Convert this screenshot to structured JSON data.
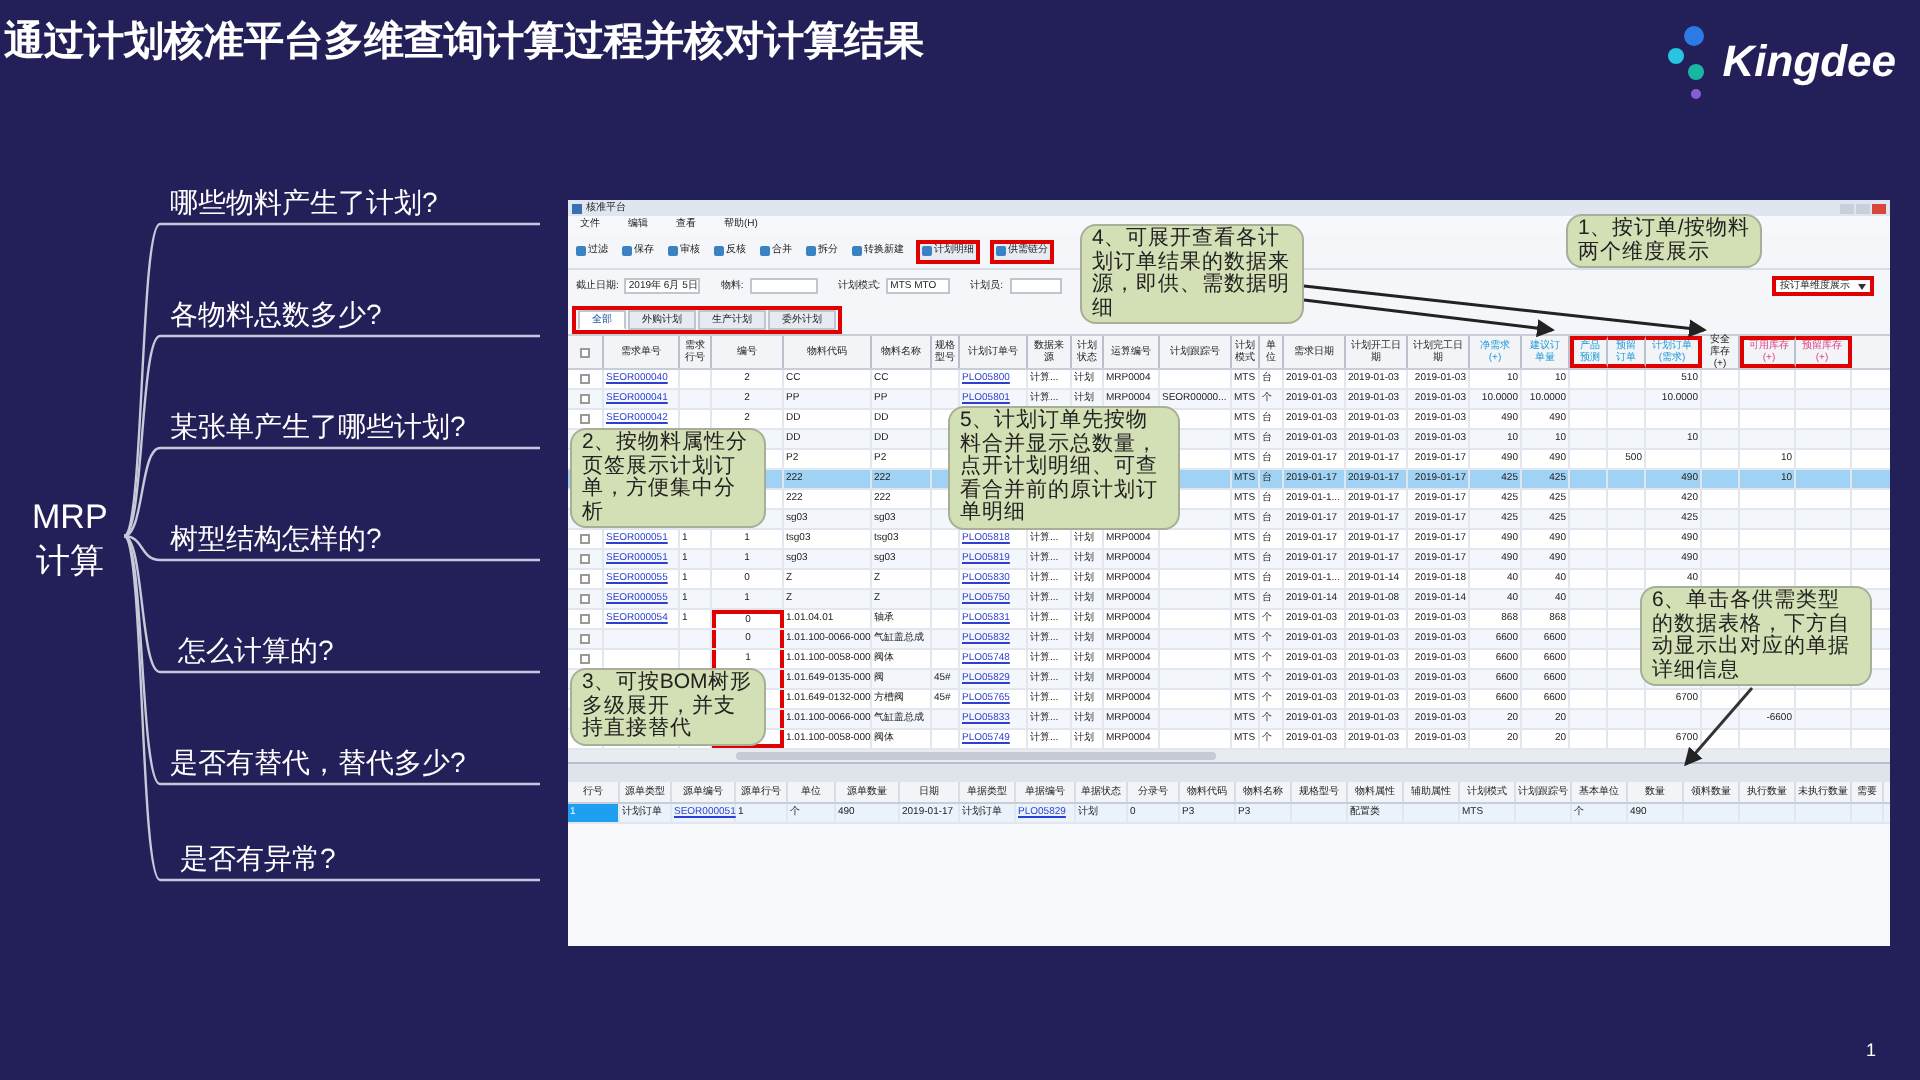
{
  "title": "通过计划核准平台多维查询计算过程并核对计算结果",
  "logo": {
    "text": "Kingdee"
  },
  "topic": {
    "lines": [
      "MRP",
      "计算"
    ]
  },
  "questions": [
    "哪些物料产生了计划?",
    "各物料总数多少?",
    "某张单产生了哪些计划?",
    "树型结构怎样的?",
    "怎么计算的?",
    "是否有替代，替代多少?",
    "是否有异常?"
  ],
  "app": {
    "title": "核准平台",
    "menu": [
      "文件",
      "编辑",
      "查看",
      "帮助(H)"
    ],
    "toolbar": [
      {
        "label": "过滤",
        "outlined": false
      },
      {
        "label": "保存",
        "outlined": false
      },
      {
        "label": "审核",
        "outlined": false
      },
      {
        "label": "反核",
        "outlined": false
      },
      {
        "label": "合并",
        "outlined": false
      },
      {
        "label": "拆分",
        "outlined": false
      },
      {
        "label": "转换新建",
        "outlined": false
      },
      {
        "label": "计划明细",
        "outlined": true
      },
      {
        "label": "供需链分",
        "outlined": true
      }
    ],
    "filters": [
      {
        "label": "截止日期:",
        "value": "2019年 6月 5日"
      },
      {
        "label": "物料:"
      },
      {
        "label": "计划模式:",
        "value": "MTS MTO"
      },
      {
        "label": "计划员:"
      }
    ],
    "view_select": {
      "value": "按订单维度展示",
      "outlined": true
    },
    "tabs_outlined": true,
    "tabs": [
      {
        "label": "全部",
        "selected": true
      },
      {
        "label": "外购计划",
        "selected": false
      },
      {
        "label": "生产计划",
        "selected": false
      },
      {
        "label": "委外计划",
        "selected": false
      }
    ],
    "table": {
      "select_all_checked": false,
      "columns": [
        {
          "label": "需求单号",
          "outlined": false,
          "kind": "plain"
        },
        {
          "label": "需求行号",
          "outlined": false,
          "kind": "plain"
        },
        {
          "label": "编号",
          "outlined": false,
          "kind": "plain"
        },
        {
          "label": "物料代码",
          "outlined": false,
          "kind": "plain"
        },
        {
          "label": "物料名称",
          "outlined": false,
          "kind": "plain"
        },
        {
          "label": "规格型号",
          "outlined": false,
          "kind": "plain"
        },
        {
          "label": "计划订单号",
          "outlined": false,
          "kind": "plain"
        },
        {
          "label": "数据来源",
          "outlined": false,
          "kind": "plain"
        },
        {
          "label": "计划状态",
          "outlined": false,
          "kind": "plain"
        },
        {
          "label": "运算编号",
          "outlined": false,
          "kind": "plain"
        },
        {
          "label": "计划跟踪号",
          "outlined": false,
          "kind": "plain"
        },
        {
          "label": "计划模式",
          "outlined": false,
          "kind": "plain"
        },
        {
          "label": "单位",
          "outlined": false,
          "kind": "plain"
        },
        {
          "label": "需求日期",
          "outlined": false,
          "kind": "plain"
        },
        {
          "label": "计划开工日期",
          "outlined": false,
          "kind": "plain"
        },
        {
          "label": "计划完工日期",
          "outlined": false,
          "kind": "plain"
        },
        {
          "label": "净需求(+)",
          "outlined": false,
          "kind": "demand"
        },
        {
          "label": "建议订单量",
          "outlined": false,
          "kind": "demand"
        },
        {
          "label": "产品预测",
          "outlined": true,
          "kind": "demand"
        },
        {
          "label": "预留订单",
          "outlined": true,
          "kind": "demand"
        },
        {
          "label": "计划订单(需求)",
          "outlined": true,
          "kind": "demand"
        },
        {
          "label": "安全库存(+)",
          "outlined": false,
          "kind": "plain"
        },
        {
          "label": "可用库存(+)",
          "outlined": true,
          "kind": "stock"
        },
        {
          "label": "预留库存(+)",
          "outlined": true,
          "kind": "stock"
        }
      ],
      "rows": [
        {
          "selected": false,
          "checked": false,
          "code_outlined": false,
          "cells": [
            "SEOR000040",
            "",
            "2",
            "CC",
            "CC",
            "",
            "PLO05800",
            "计算...",
            "计划",
            "MRP0004",
            "",
            "MTS",
            "台",
            "2019-01-03",
            "2019-01-03",
            "2019-01-03",
            "10",
            "10",
            "",
            "",
            "510",
            "",
            "",
            ""
          ]
        },
        {
          "selected": false,
          "checked": false,
          "code_outlined": false,
          "cells": [
            "SEOR000041",
            "",
            "2",
            "PP",
            "PP",
            "",
            "PLO05801",
            "计算...",
            "计划",
            "MRP0004",
            "SEOR00000...",
            "MTS",
            "个",
            "2019-01-03",
            "2019-01-03",
            "2019-01-03",
            "10.0000",
            "10.0000",
            "",
            "",
            "10.0000",
            "",
            "",
            ""
          ]
        },
        {
          "selected": false,
          "checked": false,
          "code_outlined": false,
          "cells": [
            "SEOR000042",
            "",
            "2",
            "DD",
            "DD",
            "",
            "",
            "",
            "",
            "",
            "",
            "MTS",
            "台",
            "2019-01-03",
            "2019-01-03",
            "2019-01-03",
            "490",
            "490",
            "",
            "",
            "",
            "",
            "",
            ""
          ]
        },
        {
          "selected": false,
          "code_outlined": false,
          "cells": [
            "",
            "",
            "",
            "DD",
            "DD",
            "",
            "",
            "",
            "",
            "",
            "",
            "MTS",
            "台",
            "2019-01-03",
            "2019-01-03",
            "2019-01-03",
            "10",
            "10",
            "",
            "",
            "10",
            "",
            "",
            ""
          ]
        },
        {
          "selected": false,
          "code_outlined": false,
          "cells": [
            "",
            "",
            "",
            "P2",
            "P2",
            "",
            "",
            "",
            "",
            "",
            "",
            "MTS",
            "台",
            "2019-01-17",
            "2019-01-17",
            "2019-01-17",
            "490",
            "490",
            "",
            "500",
            "",
            "",
            "10",
            ""
          ]
        },
        {
          "selected": true,
          "code_outlined": false,
          "cells": [
            "",
            "",
            "",
            "222",
            "222",
            "",
            "",
            "",
            "",
            "",
            "",
            "MTS",
            "台",
            "2019-01-17",
            "2019-01-17",
            "2019-01-17",
            "425",
            "425",
            "",
            "",
            "490",
            "",
            "10",
            ""
          ]
        },
        {
          "selected": false,
          "code_outlined": false,
          "cells": [
            "",
            "",
            "",
            "222",
            "222",
            "",
            "",
            "",
            "",
            "",
            "",
            "MTS",
            "台",
            "2019-01-1...",
            "2019-01-17",
            "2019-01-17",
            "425",
            "425",
            "",
            "",
            "420",
            "",
            "",
            ""
          ]
        },
        {
          "selected": false,
          "code_outlined": false,
          "cells": [
            "",
            "",
            "",
            "sg03",
            "sg03",
            "",
            "",
            "",
            "",
            "",
            "",
            "MTS",
            "台",
            "2019-01-17",
            "2019-01-17",
            "2019-01-17",
            "425",
            "425",
            "",
            "",
            "425",
            "",
            "",
            ""
          ]
        },
        {
          "selected": false,
          "checked": false,
          "code_outlined": false,
          "cells": [
            "SEOR000051",
            "1",
            "1",
            "tsg03",
            "tsg03",
            "",
            "PLO05818",
            "计算...",
            "计划",
            "MRP0004",
            "",
            "MTS",
            "台",
            "2019-01-17",
            "2019-01-17",
            "2019-01-17",
            "490",
            "490",
            "",
            "",
            "490",
            "",
            "",
            ""
          ]
        },
        {
          "selected": false,
          "checked": false,
          "code_outlined": false,
          "cells": [
            "SEOR000051",
            "1",
            "1",
            "sg03",
            "sg03",
            "",
            "PLO05819",
            "计算...",
            "计划",
            "MRP0004",
            "",
            "MTS",
            "台",
            "2019-01-17",
            "2019-01-17",
            "2019-01-17",
            "490",
            "490",
            "",
            "",
            "490",
            "",
            "",
            ""
          ]
        },
        {
          "selected": false,
          "checked": false,
          "code_outlined": false,
          "cells": [
            "SEOR000055",
            "1",
            "0",
            "Z",
            "Z",
            "",
            "PLO05830",
            "计算...",
            "计划",
            "MRP0004",
            "",
            "MTS",
            "台",
            "2019-01-1...",
            "2019-01-14",
            "2019-01-18",
            "40",
            "40",
            "",
            "",
            "40",
            "",
            "",
            ""
          ]
        },
        {
          "selected": false,
          "checked": false,
          "code_outlined": false,
          "cells": [
            "SEOR000055",
            "1",
            "1",
            "Z",
            "Z",
            "",
            "PLO05750",
            "计算...",
            "计划",
            "MRP0004",
            "",
            "MTS",
            "台",
            "2019-01-14",
            "2019-01-08",
            "2019-01-14",
            "40",
            "40",
            "",
            "",
            "",
            "",
            "",
            ""
          ]
        },
        {
          "selected": false,
          "checked": false,
          "code_outlined": true,
          "cells": [
            "SEOR000054",
            "1",
            "0",
            "1.01.04.01",
            "轴承",
            "",
            "PLO05831",
            "计算...",
            "计划",
            "MRP0004",
            "",
            "MTS",
            "个",
            "2019-01-03",
            "2019-01-03",
            "2019-01-03",
            "868",
            "868",
            "",
            "",
            "",
            "",
            "",
            ""
          ]
        },
        {
          "selected": false,
          "checked": false,
          "code_outlined": true,
          "cells": [
            "",
            "",
            "0",
            "1.01.100-0066-000",
            "气缸盖总成",
            "",
            "PLO05832",
            "计算...",
            "计划",
            "MRP0004",
            "",
            "MTS",
            "个",
            "2019-01-03",
            "2019-01-03",
            "2019-01-03",
            "6600",
            "6600",
            "",
            "",
            "",
            "",
            "",
            ""
          ]
        },
        {
          "selected": false,
          "checked": false,
          "code_outlined": true,
          "cells": [
            "",
            "",
            "1",
            "1.01.100-0058-000",
            "阀体",
            "",
            "PLO05748",
            "计算...",
            "计划",
            "MRP0004",
            "",
            "MTS",
            "个",
            "2019-01-03",
            "2019-01-03",
            "2019-01-03",
            "6600",
            "6600",
            "",
            "",
            "",
            "",
            "",
            ""
          ]
        },
        {
          "selected": false,
          "code_outlined": true,
          "cells": [
            "",
            "",
            "",
            "1.01.649-0135-000",
            "阀",
            "45#",
            "PLO05829",
            "计算...",
            "计划",
            "MRP0004",
            "",
            "MTS",
            "个",
            "2019-01-03",
            "2019-01-03",
            "2019-01-03",
            "6600",
            "6600",
            "",
            "",
            "",
            "",
            "",
            ""
          ]
        },
        {
          "selected": false,
          "code_outlined": true,
          "cells": [
            "",
            "",
            "",
            "1.01.649-0132-000",
            "方槽阀",
            "45#",
            "PLO05765",
            "计算...",
            "计划",
            "MRP0004",
            "",
            "MTS",
            "个",
            "2019-01-03",
            "2019-01-03",
            "2019-01-03",
            "6600",
            "6600",
            "",
            "",
            "6700",
            "",
            "",
            ""
          ]
        },
        {
          "selected": false,
          "code_outlined": true,
          "cells": [
            "",
            "",
            "",
            "1.01.100-0066-000",
            "气缸盖总成",
            "",
            "PLO05833",
            "计算...",
            "计划",
            "MRP0004",
            "",
            "MTS",
            "个",
            "2019-01-03",
            "2019-01-03",
            "2019-01-03",
            "20",
            "20",
            "",
            "",
            "",
            "",
            "-6600",
            ""
          ]
        },
        {
          "selected": false,
          "code_outlined": true,
          "cells": [
            "",
            "",
            "",
            "1.01.100-0058-000",
            "阀体",
            "",
            "PLO05749",
            "计算...",
            "计划",
            "MRP0004",
            "",
            "MTS",
            "个",
            "2019-01-03",
            "2019-01-03",
            "2019-01-03",
            "20",
            "20",
            "",
            "",
            "6700",
            "",
            "",
            ""
          ]
        }
      ]
    },
    "detail_table": {
      "columns": [
        "行号",
        "源单类型",
        "源单编号",
        "源单行号",
        "单位",
        "源单数量",
        "日期",
        "单据类型",
        "单据编号",
        "单据状态",
        "分录号",
        "物料代码",
        "物料名称",
        "规格型号",
        "物料属性",
        "辅助属性",
        "计划模式",
        "计划跟踪号",
        "基本单位",
        "数量",
        "领料数量",
        "执行数量",
        "未执行数量",
        "需要"
      ],
      "rows": [
        {
          "selected": true,
          "cells": [
            "1",
            "计划订单",
            "SEOR000051",
            "1",
            "个",
            "490",
            "2019-01-17",
            "计划订单",
            "PLO05829",
            "计划",
            "0",
            "P3",
            "P3",
            "",
            "配置类",
            "",
            "MTS",
            "",
            "个",
            "490",
            "",
            "",
            "",
            ""
          ]
        }
      ]
    }
  },
  "callouts": [
    "1、按订单/按物料两个维度展示",
    "2、按物料属性分页签展示计划订单，方便集中分析",
    "3、可按BOM树形多级展开，并支持直接替代",
    "4、可展开查看各计划订单结果的数据来源，即供、需数据明细",
    "5、计划订单先按物料合并显示总数量，点开计划明细、可查看合并前的原计划订单明细",
    "6、单击各供需类型的数据表格，下方自动显示出对应的单据详细信息"
  ],
  "page_number": "1"
}
